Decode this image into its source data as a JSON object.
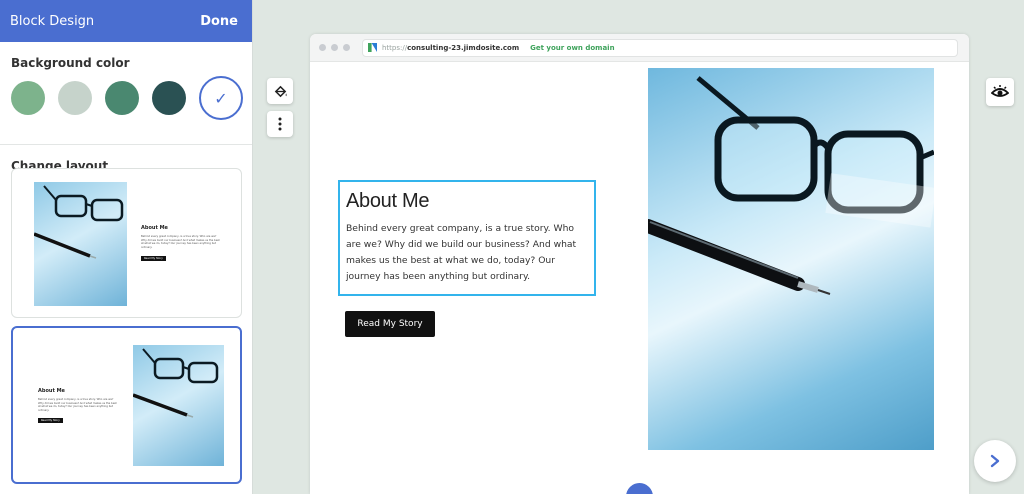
{
  "panel": {
    "title": "Block Design",
    "done_label": "Done",
    "background_color_title": "Background color",
    "swatches": [
      {
        "color": "#7db38c"
      },
      {
        "color": "#c6d3cb"
      },
      {
        "color": "#4a8870"
      },
      {
        "color": "#2a5153"
      },
      {
        "color": "#ffffff",
        "selected": true
      }
    ],
    "check_glyph": "✓",
    "change_layout_title": "Change layout",
    "layouts": [
      {
        "heading": "About Me",
        "text": "Behind every great company, is a true story. Who are we? Why did we build our business? And what makes us the best at what we do, today? Our journey has been anything but ordinary.",
        "button": "Read My Story"
      },
      {
        "heading": "About Me",
        "text": "Behind every great company, is a true story. Who are we? Why did we build our business? And what makes us the best at what we do, today? Our journey has been anything but ordinary.",
        "button": "Read My Story",
        "selected": true
      }
    ]
  },
  "browser": {
    "url_proto": "https://",
    "url_host": "consulting-23.jimdosite.com",
    "domain_cta": "Get your own domain"
  },
  "content": {
    "heading": "About Me",
    "body": "Behind every great company, is a true story. Who are we? Why did we build our business? And what makes us the best at what we do, today? Our journey has been anything but ordinary.",
    "button": "Read My Story"
  },
  "tools": {
    "paint_icon": "paint-bucket-icon",
    "more_icon": "more-vertical-icon",
    "preview_icon": "eye-icon",
    "next_icon": "chevron-right-icon"
  },
  "colors": {
    "accent": "#4a6ed0",
    "selection_border": "#33b4ec",
    "cta_green": "#3fa35c"
  }
}
